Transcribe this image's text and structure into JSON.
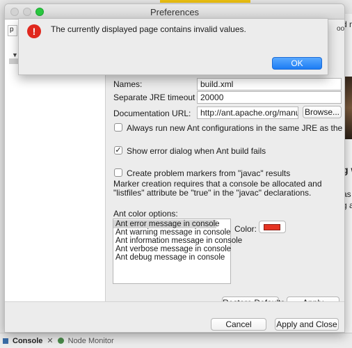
{
  "window": {
    "title": "Preferences"
  },
  "left": {
    "filter_text": "p"
  },
  "names": {
    "label": "Names:",
    "value": "build.xml"
  },
  "jre_timeout": {
    "label": "Separate JRE timeout (ms):",
    "value": "20000"
  },
  "doc_url": {
    "label": "Documentation URL:",
    "value": "http://ant.apache.org/manual",
    "browse_label": "Browse..."
  },
  "options": {
    "always_run_label": "Always run new Ant configurations in the same JRE as the workspace",
    "always_run_checked": false,
    "show_error_label": "Show error dialog when Ant build fails",
    "show_error_checked": true,
    "markers_label": "Create problem markers from \"javac\" results",
    "markers_checked": false,
    "markers_note": "Marker creation requires that a console be allocated and \"listfiles\" attribute be \"true\" in the \"javac\" declarations."
  },
  "color_options": {
    "label": "Ant color options:",
    "items": [
      "Ant error message in console",
      "Ant warning message in console",
      "Ant information message in console",
      "Ant verbose message in console",
      "Ant debug message in console"
    ],
    "selected_index": 0,
    "color_label": "Color:",
    "color_value": "#e53423"
  },
  "buttons": {
    "restore_defaults": "Restore Defaults",
    "apply": "Apply",
    "cancel": "Cancel",
    "apply_close": "Apply and Close"
  },
  "alert": {
    "message": "The currently displayed page contains invalid values.",
    "ok_label": "OK",
    "icon": "error-exclamation-icon"
  },
  "background": {
    "bottom_console": "Console",
    "bottom_node_monitor": "Node Monitor",
    "partial_text": "ooo",
    "partial_text_2": "d n"
  }
}
